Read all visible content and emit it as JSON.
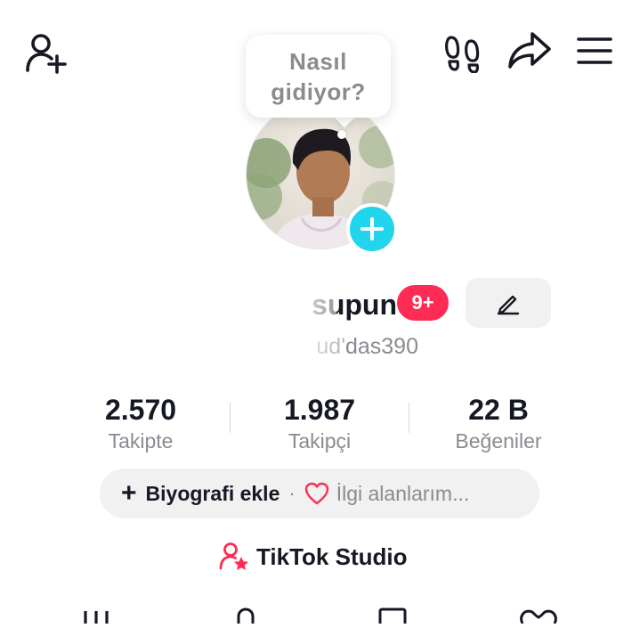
{
  "header": {
    "add_friend_icon": "person-add-icon",
    "footprint_icon": "footprints-icon",
    "share_icon": "share-arrow-icon",
    "menu_icon": "hamburger-menu-icon"
  },
  "bubble": {
    "text": "Nasıl gidiyor?"
  },
  "profile": {
    "display_name": "supun",
    "notification_badge": "9+",
    "username": "ud'das390"
  },
  "stats": [
    {
      "value": "2.570",
      "label": "Takipte"
    },
    {
      "value": "1.987",
      "label": "Takipçi"
    },
    {
      "value": "22 B",
      "label": "Beğeniler"
    }
  ],
  "bio": {
    "plus": "+",
    "add_bio": "Biyografi ekle",
    "separator": "·",
    "interests": "İlgi alanlarım..."
  },
  "studio": {
    "label": "TikTok Studio"
  },
  "colors": {
    "accent": "#fe2c55",
    "story": "#20d5ec",
    "muted": "#8a8b91"
  }
}
